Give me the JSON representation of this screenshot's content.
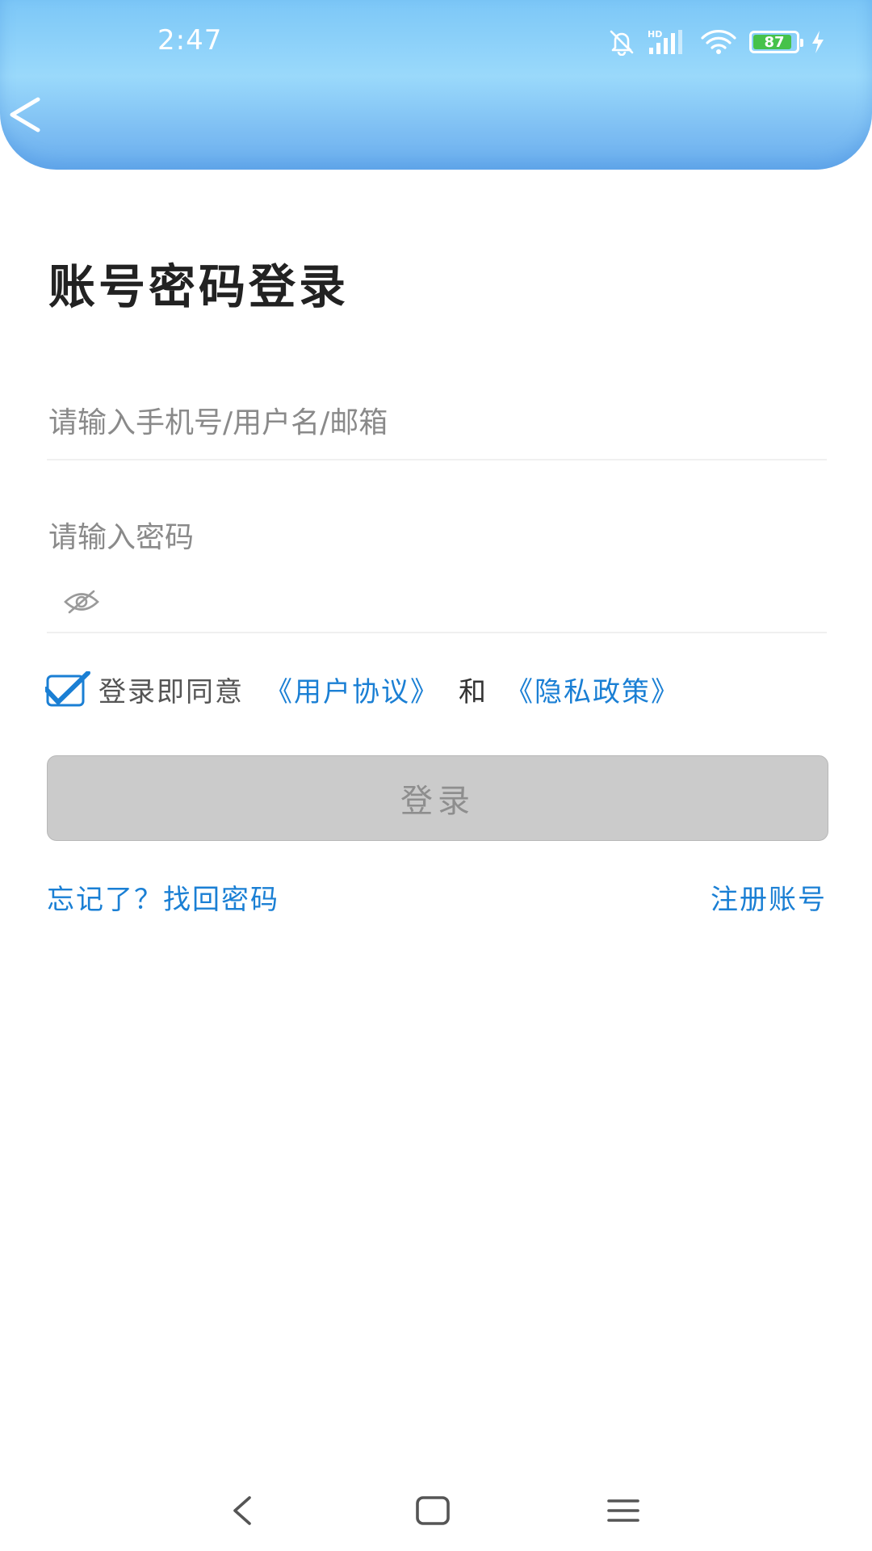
{
  "status_bar": {
    "time": "2:47",
    "battery_level": "87",
    "icons": [
      "mute-bell-icon",
      "hd-signal-icon",
      "wifi-icon",
      "battery-icon",
      "charging-icon"
    ]
  },
  "header": {
    "back_icon": "chevron-left-icon"
  },
  "main": {
    "title": "账号密码登录",
    "account_placeholder": "请输入手机号/用户名/邮箱",
    "password_placeholder": "请输入密码",
    "password_visibility_icon": "eye-off-icon",
    "agreement": {
      "checked": true,
      "prefix": "登录即同意",
      "user_agreement": "《用户协议》",
      "and": "和",
      "privacy_policy": "《隐私政策》"
    },
    "login_label": "登录",
    "forgot_label": "忘记了？找回密码",
    "register_label": "注册账号"
  },
  "nav_bar": {
    "icons": [
      "nav-back-icon",
      "nav-home-icon",
      "nav-menu-icon"
    ]
  },
  "colors": {
    "accent": "#1a7fd4",
    "header_gradient_top": "#7cc7f7",
    "header_gradient_bottom": "#6aaeee",
    "disabled_button": "#cbcbcb",
    "checkbox": "#1a7fd4"
  }
}
